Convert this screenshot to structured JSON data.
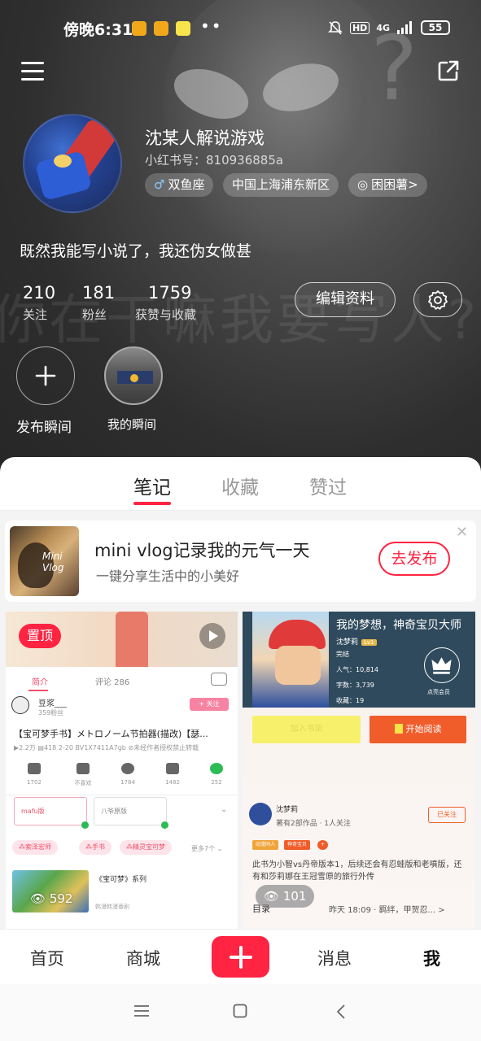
{
  "status_bar": {
    "time": "傍晚6:31",
    "dots": "••",
    "network": "4G",
    "hd": "HD",
    "battery": "55"
  },
  "profile": {
    "name": "沈某人解说游戏",
    "id_label": "小红书号：810936885a",
    "tags": [
      "双鱼座",
      "中国上海浦东新区",
      "困困薯>"
    ],
    "bio": "既然我能写小说了，我还伪女做甚",
    "stats": [
      {
        "value": "210",
        "label": "关注"
      },
      {
        "value": "181",
        "label": "粉丝"
      },
      {
        "value": "1759",
        "label": "获赞与收藏"
      }
    ],
    "edit_button": "编辑资料"
  },
  "background_watermark": "你在干嘛我要写人?",
  "moments": {
    "publish_label": "发布瞬间",
    "mine_label": "我的瞬间"
  },
  "tabs": [
    "笔记",
    "收藏",
    "赞过"
  ],
  "active_tab": 0,
  "promo": {
    "title": "mini vlog记录我的元气一天",
    "subtitle": "一键分享生活中的小美好",
    "button": "去发布",
    "image_text": "Mini Vlog"
  },
  "note1": {
    "pin_label": "置顶",
    "tab_intro": "简介",
    "tab_comments": "评论 286",
    "uploader": "豆浆___",
    "fans": "359粉丝",
    "follow": "+ 关注",
    "title": "【宝可梦手书】メトロノーム节拍器(描改)【瑟...",
    "meta": "▶2.2万 ▤418 2-20 BV1X7411A7gb ⊘未经作者授权禁止转载",
    "actions": [
      {
        "label": "1702"
      },
      {
        "label": "不喜欢"
      },
      {
        "label": "1784"
      },
      {
        "label": "1482"
      },
      {
        "label": "252"
      }
    ],
    "box1": "mafu版",
    "box2": "八爷原版",
    "pills": [
      "⁂索泽宏师",
      "⁂手书",
      "⁂精灵宝可梦"
    ],
    "more": "更多7个 ⌄",
    "series_title": "《宝可梦》系列",
    "series_sub": "韩漫韩漫番剧",
    "views": "592"
  },
  "note2": {
    "title": "我的梦想，神奇宝贝大师",
    "author": "沈梦莉",
    "level": "Lv1",
    "status": "完结",
    "popularity": "人气：10,814",
    "words": "字数：3,739",
    "favorites": "收藏：19",
    "crown_label": "点亮会员",
    "btn_yellow": "加入书架",
    "btn_orange": "开始阅读",
    "author_name": "沈梦莉",
    "works": "著有2部作品 · 1人关注",
    "followed": "已关注",
    "chips": [
      "动漫同人",
      "神奇宝贝",
      "+"
    ],
    "description": "此书为小智vs丹帝版本1，后续还会有忍蛙版和老噴版，还有和莎莉娜在王冠雪原的旅行外传",
    "toc_label": "目录",
    "toc_meta": "昨天 18:09 · 羁绊，甲贺忍...  >",
    "views": "101"
  },
  "bottom_nav": {
    "items": [
      "首页",
      "商城",
      "消息",
      "我"
    ],
    "active_index": 3
  },
  "colors": {
    "accent": "#ff2442",
    "header_bg": "#2e2e2e"
  }
}
